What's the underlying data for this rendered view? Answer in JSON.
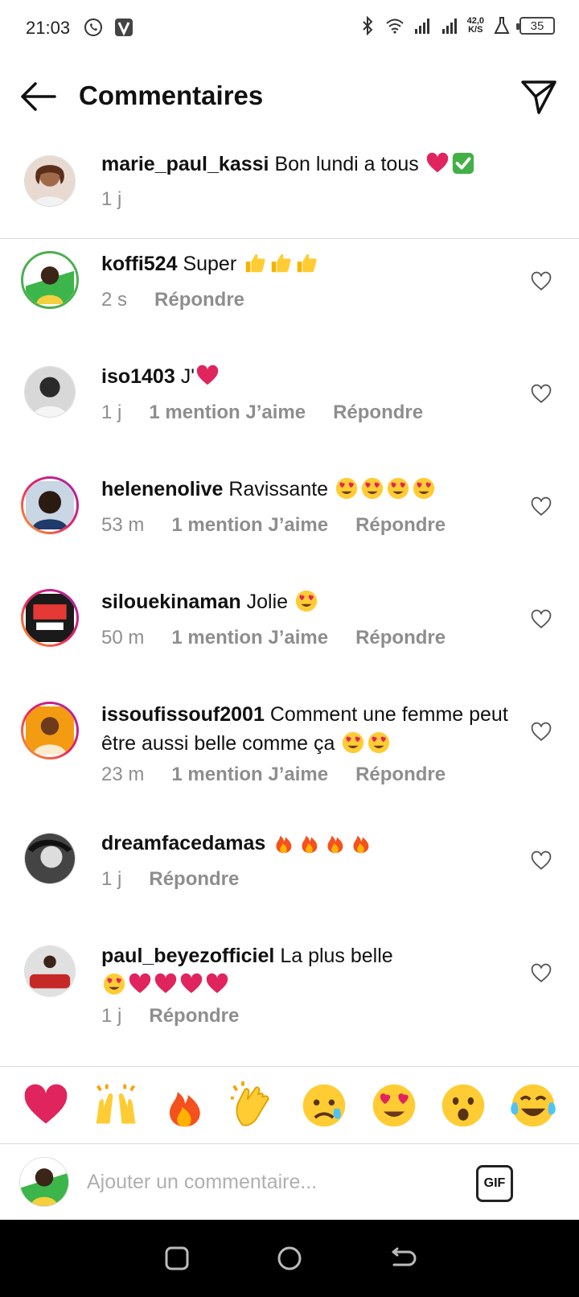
{
  "status_bar": {
    "time": "21:03",
    "speed_value": "42,0",
    "speed_unit": "K/S",
    "battery": "35"
  },
  "header": {
    "title": "Commentaires"
  },
  "caption": {
    "username": "marie_paul_kassi",
    "text": "Bon lundi a tous",
    "time": "1 j"
  },
  "comments": [
    {
      "username": "koffi524",
      "text": "Super",
      "time": "2 s",
      "likes": "",
      "reply": "Répondre"
    },
    {
      "username": "iso1403",
      "text": "J'",
      "time": "1 j",
      "likes": "1 mention J’aime",
      "reply": "Répondre"
    },
    {
      "username": "helenenolive",
      "text": "Ravissante",
      "time": "53 m",
      "likes": "1 mention J’aime",
      "reply": "Répondre"
    },
    {
      "username": "silouekinaman",
      "text": "Jolie",
      "time": "50 m",
      "likes": "1 mention J’aime",
      "reply": "Répondre"
    },
    {
      "username": "issoufissouf2001",
      "text": "Comment une femme peut être aussi belle comme ça",
      "time": "23 m",
      "likes": "1 mention J’aime",
      "reply": "Répondre"
    },
    {
      "username": "dreamfacedamas",
      "text": "",
      "time": "1 j",
      "likes": "",
      "reply": "Répondre"
    },
    {
      "username": "paul_beyezofficiel",
      "text": "La plus belle",
      "time": "1 j",
      "likes": "",
      "reply": "Répondre"
    }
  ],
  "quick_emojis": [
    "red-heart",
    "raising-hands",
    "fire",
    "clapping-hands",
    "crying-face",
    "heart-eyes",
    "surprised-face",
    "tears-of-joy"
  ],
  "input": {
    "placeholder": "Ajouter un commentaire...",
    "gif_label": "GIF"
  },
  "colors": {
    "muted": "#8e8e8e",
    "heart": "#e0245e",
    "story_ring": "#e91e63",
    "green_ring": "#4caf50"
  }
}
